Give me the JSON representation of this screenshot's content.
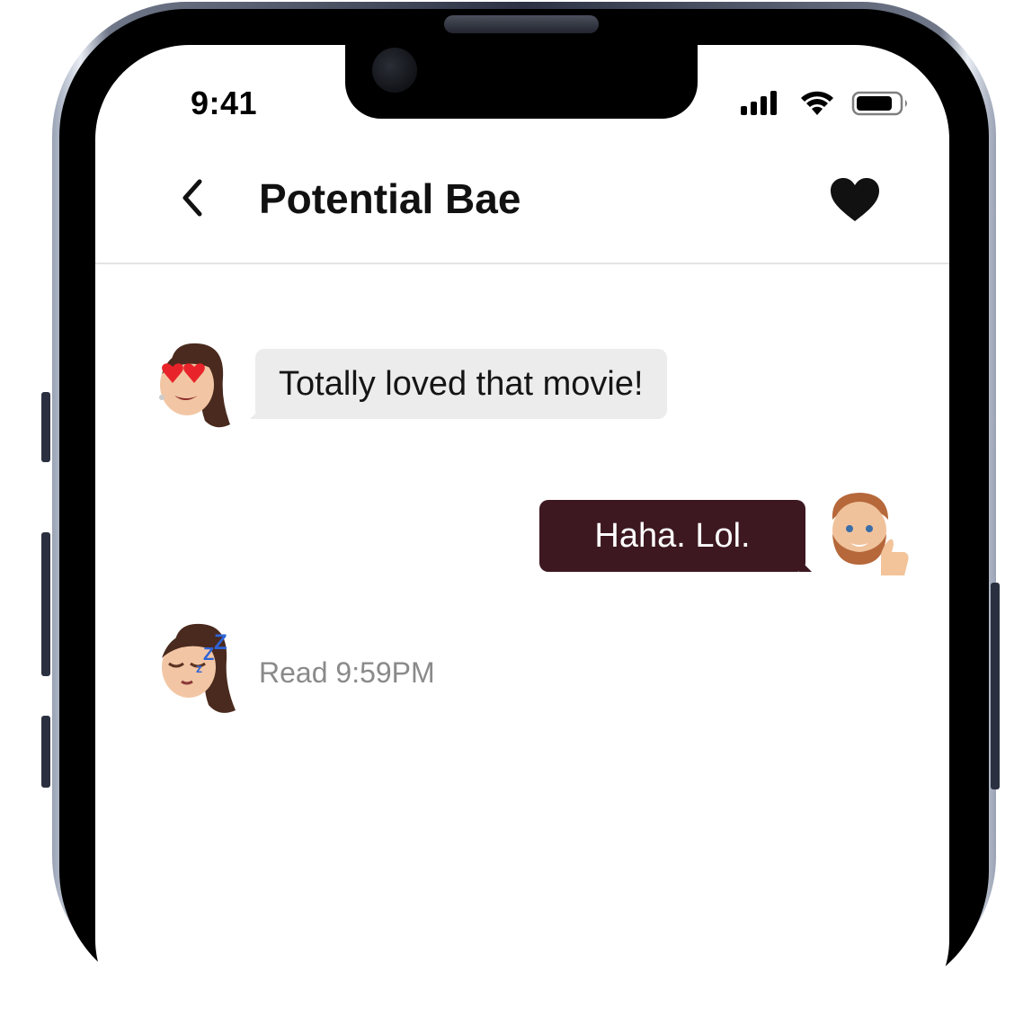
{
  "status_bar": {
    "time": "9:41"
  },
  "header": {
    "title": "Potential Bae"
  },
  "messages": [
    {
      "direction": "incoming",
      "text": "Totally loved that movie!",
      "avatar": "memoji-heart-eyes"
    },
    {
      "direction": "outgoing",
      "text": "Haha. Lol.",
      "avatar": "memoji-thumbs-up"
    }
  ],
  "read_receipt": {
    "text": "Read 9:59PM",
    "avatar": "memoji-sleeping"
  },
  "colors": {
    "incoming_bubble": "#ececec",
    "outgoing_bubble": "#3d1820",
    "receipt_text": "#8a8a8a"
  },
  "icons": [
    "back-chevron-icon",
    "heart-icon",
    "signal-icon",
    "wifi-icon",
    "battery-icon"
  ]
}
